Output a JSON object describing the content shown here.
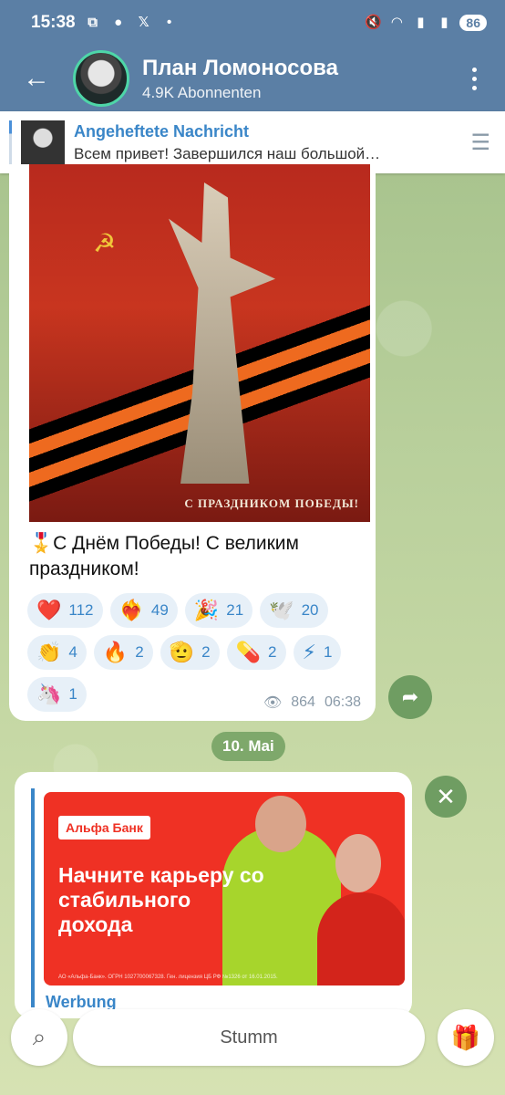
{
  "statusbar": {
    "time": "15:38",
    "battery": "86"
  },
  "header": {
    "title": "План Ломоносова",
    "subtitle": "4.9K Abonnenten"
  },
  "pinned": {
    "title": "Angeheftete Nachricht",
    "message": "Всем привет!  Завершился наш большой…"
  },
  "post": {
    "image_caption": "С ПРАЗДНИКОМ ПОБЕДЫ!",
    "caption": "🎖️С Днём Победы! С великим праздником!",
    "reactions_row1": [
      {
        "emoji": "❤️",
        "count": "112"
      },
      {
        "emoji": "❤️‍🔥",
        "count": "49"
      },
      {
        "emoji": "🎉",
        "count": "21"
      },
      {
        "emoji": "🕊️",
        "count": "20"
      }
    ],
    "reactions_row2": [
      {
        "emoji": "👏",
        "count": "4"
      },
      {
        "emoji": "🔥",
        "count": "2"
      },
      {
        "emoji": "🫡",
        "count": "2"
      },
      {
        "emoji": "💊",
        "count": "2"
      },
      {
        "emoji": "⚡",
        "count": "1"
      }
    ],
    "reactions_row3": [
      {
        "emoji": "🦄",
        "count": "1"
      }
    ],
    "views": "864",
    "time": "06:38"
  },
  "date_chip": "10. Mai",
  "ad": {
    "brand": "Альфа Банк",
    "headline": "Начните карьеру со стабильного дохода",
    "fine_print": "АО «Альфа-Банк». ОГРН 1027700067328. Ген. лицензия ЦБ РФ №1326 от 16.01.2015.",
    "label": "Werbung"
  },
  "bottom": {
    "mute_label": "Stumm"
  },
  "colors": {
    "header": "#5b7fa5",
    "accent": "#3a86c8",
    "alfa_red": "#ef3124"
  }
}
